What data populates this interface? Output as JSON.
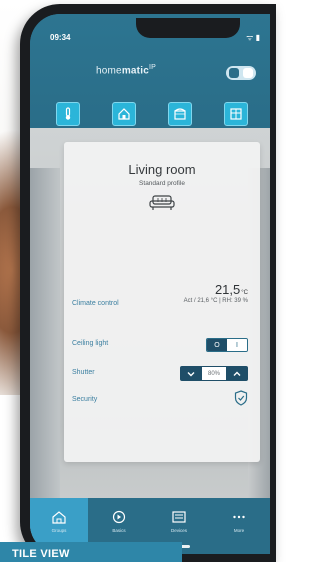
{
  "status_bar": {
    "time": "09:34",
    "icons": "ᯤ ▮"
  },
  "header": {
    "brand_prefix": "home",
    "brand_bold": "matic",
    "brand_suffix": "IP",
    "view_toggle": "tile-view-toggle"
  },
  "category_buttons": [
    {
      "icon": "thermometer-icon"
    },
    {
      "icon": "house-icon"
    },
    {
      "icon": "shutter-icon"
    },
    {
      "icon": "window-icon"
    }
  ],
  "room_card": {
    "title": "Living room",
    "profile": "Standard profile",
    "icon": "sofa-icon",
    "rows": [
      {
        "label": "Climate control"
      },
      {
        "label": "Ceiling light"
      },
      {
        "label": "Shutter"
      },
      {
        "label": "Security"
      }
    ],
    "temperature": {
      "value": "21,5",
      "unit": "°C",
      "meta": "Act / 21,6 °C | RH: 39 %"
    },
    "light": {
      "on_label": "O",
      "off_label": "I"
    },
    "shutter": {
      "level_text": "80%"
    },
    "security_icon": "shield-check-icon"
  },
  "bottom_nav": [
    {
      "label": "Groups",
      "icon": "home-nav-icon",
      "active": true
    },
    {
      "label": "Basics",
      "icon": "basics-nav-icon",
      "active": false
    },
    {
      "label": "Devices",
      "icon": "devices-nav-icon",
      "active": false
    },
    {
      "label": "More",
      "icon": "more-dots-icon",
      "active": false
    }
  ],
  "caption": "TILE VIEW",
  "colors": {
    "primary": "#2a6d88",
    "accent": "#2bb5d9",
    "nav_active": "#3a9fc7",
    "dark_button": "#1f4e68",
    "caption_bg": "#2e86a8"
  }
}
